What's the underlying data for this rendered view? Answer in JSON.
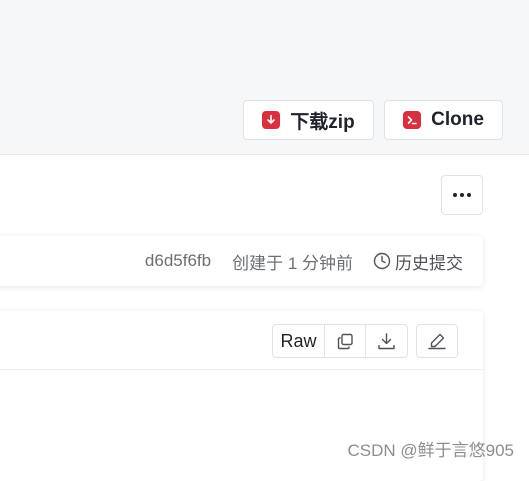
{
  "header": {
    "download_label": "下载zip",
    "clone_label": "Clone"
  },
  "commit": {
    "hash": "d6d5f6fb",
    "created": "创建于 1 分钟前",
    "history_label": "历史提交"
  },
  "file_toolbar": {
    "raw_label": "Raw"
  },
  "watermark": "CSDN @鲜于言悠905",
  "colors": {
    "accent": "#d8303e",
    "header_bg": "#f6f7f9",
    "text_muted": "#6b7075"
  },
  "icons": {
    "download": "download-icon",
    "clone": "terminal-icon",
    "more": "more-horizontal-icon",
    "history": "clock-icon",
    "copy": "copy-icon",
    "file_download": "download-tray-icon",
    "edit": "edit-icon"
  }
}
